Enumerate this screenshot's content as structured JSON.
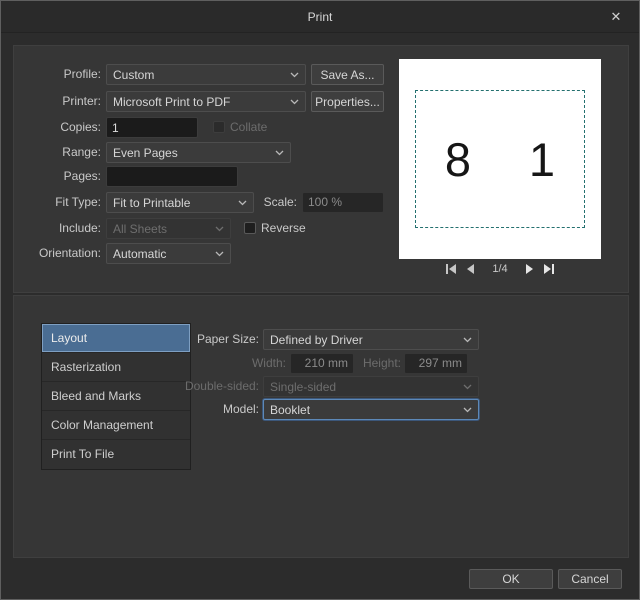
{
  "window": {
    "title": "Print",
    "close_glyph": "✕"
  },
  "top": {
    "profile_label": "Profile:",
    "profile_value": "Custom",
    "save_as_button": "Save As...",
    "printer_label": "Printer:",
    "printer_value": "Microsoft Print to PDF",
    "properties_button": "Properties...",
    "copies_label": "Copies:",
    "copies_value": "1",
    "collate_label": "Collate",
    "range_label": "Range:",
    "range_value": "Even Pages",
    "pages_label": "Pages:",
    "pages_value": "",
    "fit_type_label": "Fit Type:",
    "fit_type_value": "Fit to Printable",
    "scale_label": "Scale:",
    "scale_value": "100 %",
    "include_label": "Include:",
    "include_value": "All Sheets",
    "reverse_label": "Reverse",
    "orientation_label": "Orientation:",
    "orientation_value": "Automatic"
  },
  "preview": {
    "left_page_number": "8",
    "right_page_number": "1",
    "page_indicator": "1/4"
  },
  "sections": {
    "tabs": [
      "Layout",
      "Rasterization",
      "Bleed and Marks",
      "Color Management",
      "Print To File"
    ],
    "selected_tab": "Layout"
  },
  "layout_panel": {
    "paper_size_label": "Paper Size:",
    "paper_size_value": "Defined by Driver",
    "width_label": "Width:",
    "width_value": "210 mm",
    "height_label": "Height:",
    "height_value": "297 mm",
    "double_sided_label": "Double-sided:",
    "double_sided_value": "Single-sided",
    "model_label": "Model:",
    "model_value": "Booklet"
  },
  "footer": {
    "ok_button": "OK",
    "cancel_button": "Cancel"
  },
  "colors": {
    "selected_tab_bg": "#4a6d93",
    "focus_border": "#5d89b8",
    "preview_dash": "#23706f",
    "panel_bg": "#363636",
    "dialog_bg": "#2c2c2c"
  }
}
